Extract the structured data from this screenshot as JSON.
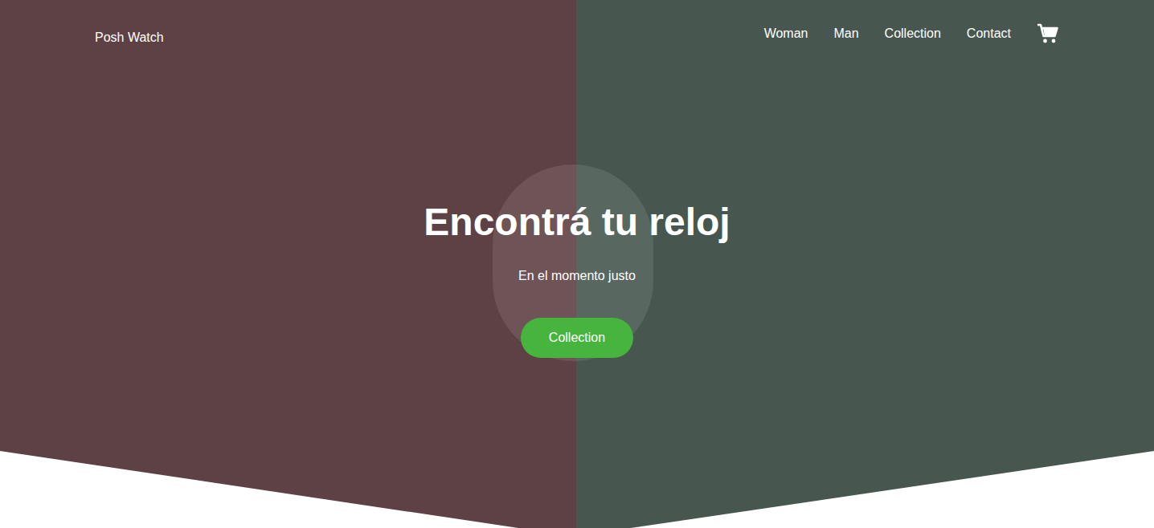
{
  "header": {
    "brand": "Posh Watch",
    "nav": [
      {
        "label": "Woman"
      },
      {
        "label": "Man"
      },
      {
        "label": "Collection"
      },
      {
        "label": "Contact"
      }
    ]
  },
  "hero": {
    "title": "Encontrá tu reloj",
    "subtitle": "En el momento justo",
    "button": "Collection"
  }
}
